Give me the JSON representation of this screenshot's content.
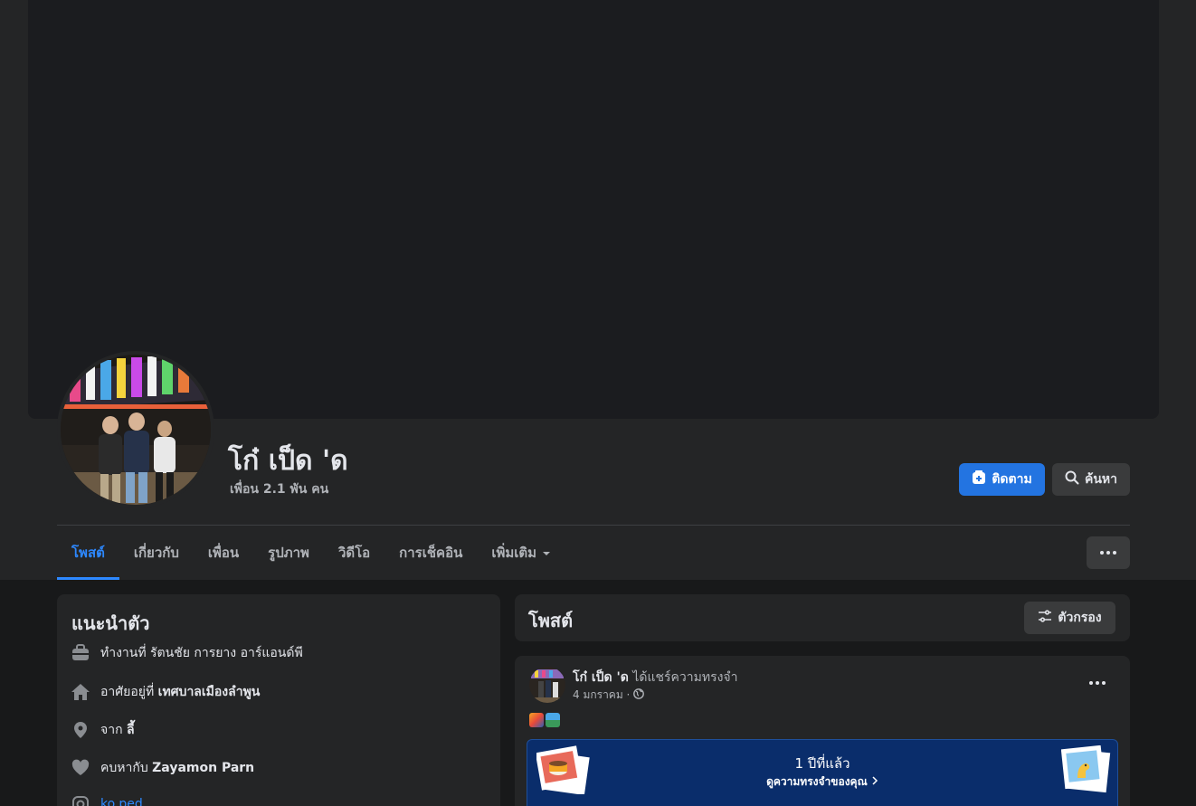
{
  "profile": {
    "name": "โก๋ เป็ด 'ด",
    "friends": "เพื่อน 2.1 พัน คน"
  },
  "actions": {
    "follow_label": "ติดตาม",
    "search_label": "ค้นหา"
  },
  "tabs": [
    {
      "label": "โพสต์",
      "active": true
    },
    {
      "label": "เกี่ยวกับ"
    },
    {
      "label": "เพื่อน"
    },
    {
      "label": "รูปภาพ"
    },
    {
      "label": "วิดีโอ"
    },
    {
      "label": "การเช็คอิน"
    },
    {
      "label": "เพิ่มเติม"
    }
  ],
  "intro": {
    "title": "แนะนำตัว",
    "work": "ทำงานที่ รัตนชัย การยาง อาร์แอนด์พี",
    "lives_prefix": "อาศัยอยู่ที่ ",
    "lives_place": "เทศบาลเมืองลำพูน",
    "from_prefix": "จาก ",
    "from_place": "ลี้",
    "relationship_prefix": "คบหากับ ",
    "relationship_name": "Zayamon Parn",
    "instagram": "ko.ped"
  },
  "posts_section": {
    "title": "โพสต์",
    "filter_label": "ตัวกรอง"
  },
  "post": {
    "author": "โก๋ เป็ด 'ด",
    "action": " ได้แชร์ความทรงจำ",
    "date": "4 มกราคม ·",
    "memory_title": "1 ปีที่แล้ว",
    "memory_link": "ดูความทรงจำของคุณ"
  },
  "colors": {
    "accent": "#2d88ff",
    "follow_button": "#2374e1",
    "memory_banner": "#0a2d6b"
  }
}
